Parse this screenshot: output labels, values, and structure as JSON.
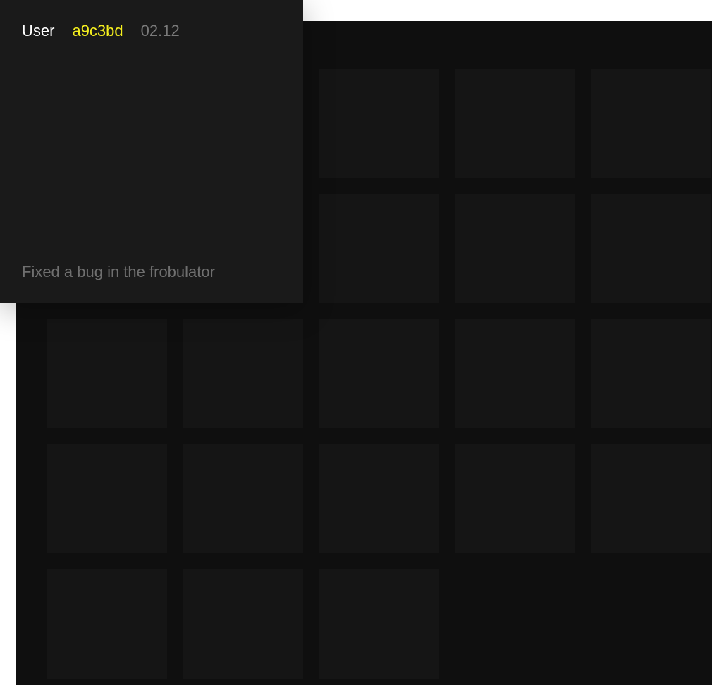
{
  "commit": {
    "user_label": "User",
    "hash": "a9c3bd",
    "date": "02.12",
    "message": "Fixed a bug in the frobulator"
  },
  "colors": {
    "background": "#ffffff",
    "backdrop": "#0f0f0f",
    "tile": "#151515",
    "card": "#1a1a1a",
    "user_text": "#ffffff",
    "hash_accent": "#f5ef1e",
    "muted_text": "#7a7a7a"
  }
}
